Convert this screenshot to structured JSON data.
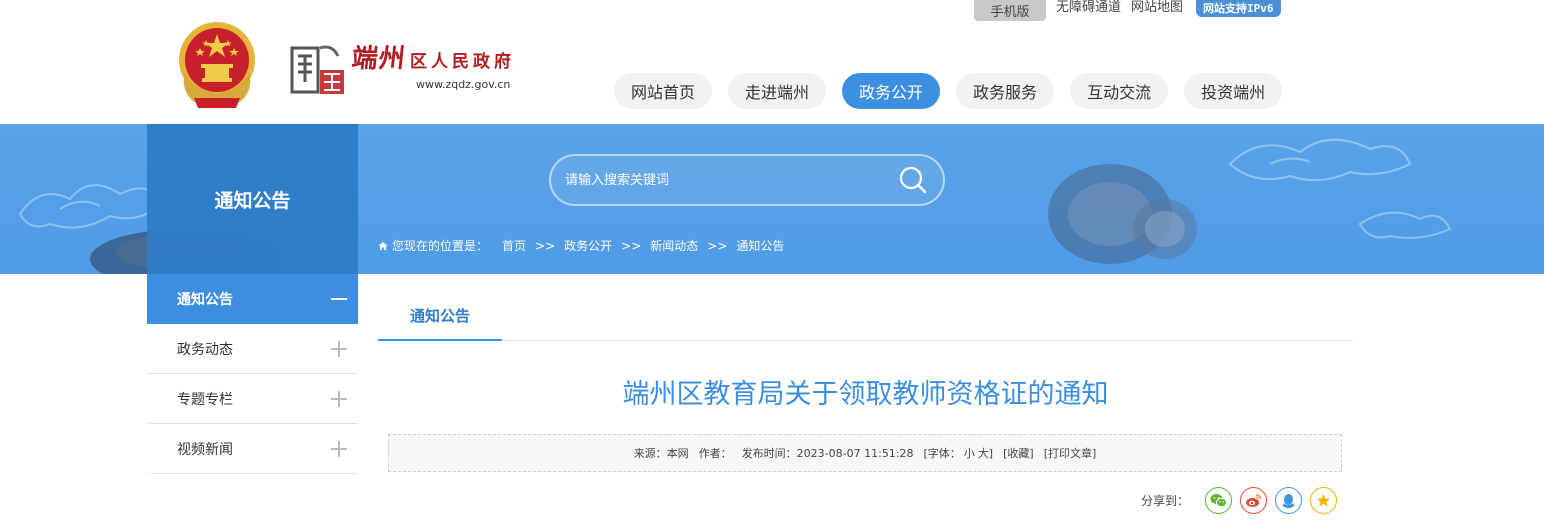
{
  "topbar": {
    "mobile_label": "手机版",
    "accessibility_label": "无障碍通道",
    "sitemap_label": "网站地图",
    "ipv6_label": "网站支持IPv6"
  },
  "logo": {
    "title_big": "端州",
    "title_small": "区人民政府",
    "url": "www.zqdz.gov.cn"
  },
  "nav": {
    "items": [
      {
        "label": "网站首页"
      },
      {
        "label": "走进端州"
      },
      {
        "label": "政务公开"
      },
      {
        "label": "政务服务"
      },
      {
        "label": "互动交流"
      },
      {
        "label": "投资端州"
      }
    ],
    "active_index": 2
  },
  "banner": {
    "section_title": "通知公告"
  },
  "search": {
    "placeholder": "请输入搜索关键词"
  },
  "breadcrumb": {
    "label": "您现在的位置是：",
    "separator": ">>",
    "items": [
      "首页",
      "政务公开",
      "新闻动态",
      "通知公告"
    ]
  },
  "sidebar": {
    "items": [
      {
        "label": "通知公告",
        "active": true
      },
      {
        "label": "政务动态",
        "active": false
      },
      {
        "label": "专题专栏",
        "active": false
      },
      {
        "label": "视频新闻",
        "active": false
      }
    ]
  },
  "content": {
    "tab_label": "通知公告",
    "article_title": "端州区教育局关于领取教师资格证的通知",
    "meta": {
      "source": "来源：本网",
      "author": "作者：",
      "publish_time": "发布时间：2023-08-07 11:51:28",
      "font_label": "[字体：",
      "font_small": "小",
      "font_large": "大]",
      "favorite": "[收藏]",
      "print": "[打印文章]"
    },
    "share_label": "分享到："
  },
  "colors": {
    "primary": "#3c8ee0",
    "dark_primary": "#2f7cc7",
    "brand_red": "#b11c22",
    "wechat": "#5cb531",
    "weibo": "#e6492d",
    "qq": "#3a96dd",
    "favorite": "#f0b400"
  }
}
